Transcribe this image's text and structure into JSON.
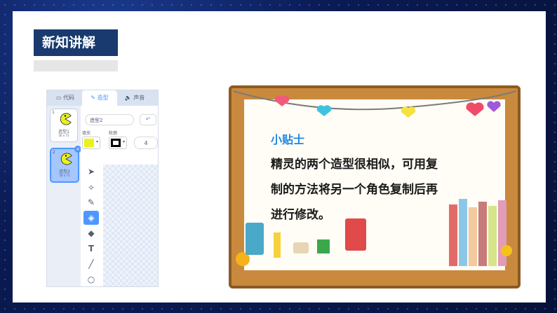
{
  "header": {
    "title": "新知讲解"
  },
  "editor": {
    "tabs": [
      {
        "label": "代码",
        "icon": "code-icon"
      },
      {
        "label": "造型",
        "icon": "brush-icon"
      },
      {
        "label": "声音",
        "icon": "sound-icon"
      }
    ],
    "costumes": [
      {
        "number": "1",
        "name": "造型1",
        "size": "50 x 71"
      },
      {
        "number": "2",
        "name": "造型2",
        "size": "50 x 71"
      }
    ],
    "costume_name_value": "造型2",
    "fill_label": "填充",
    "outline_label": "轮廓",
    "outline_width": "4",
    "colors": {
      "fill": "#e9f21a",
      "outline": "#000000",
      "accent": "#4d97ff"
    },
    "tools": [
      "select-icon",
      "reshape-icon",
      "brush-icon",
      "eraser-icon",
      "fill-icon",
      "text-icon",
      "line-icon",
      "circle-icon"
    ]
  },
  "tip": {
    "title": "小贴士",
    "lines": [
      "精灵的两个造型很相似，可用复",
      "制的方法将另一个角色复制后再",
      "进行修改。"
    ]
  }
}
